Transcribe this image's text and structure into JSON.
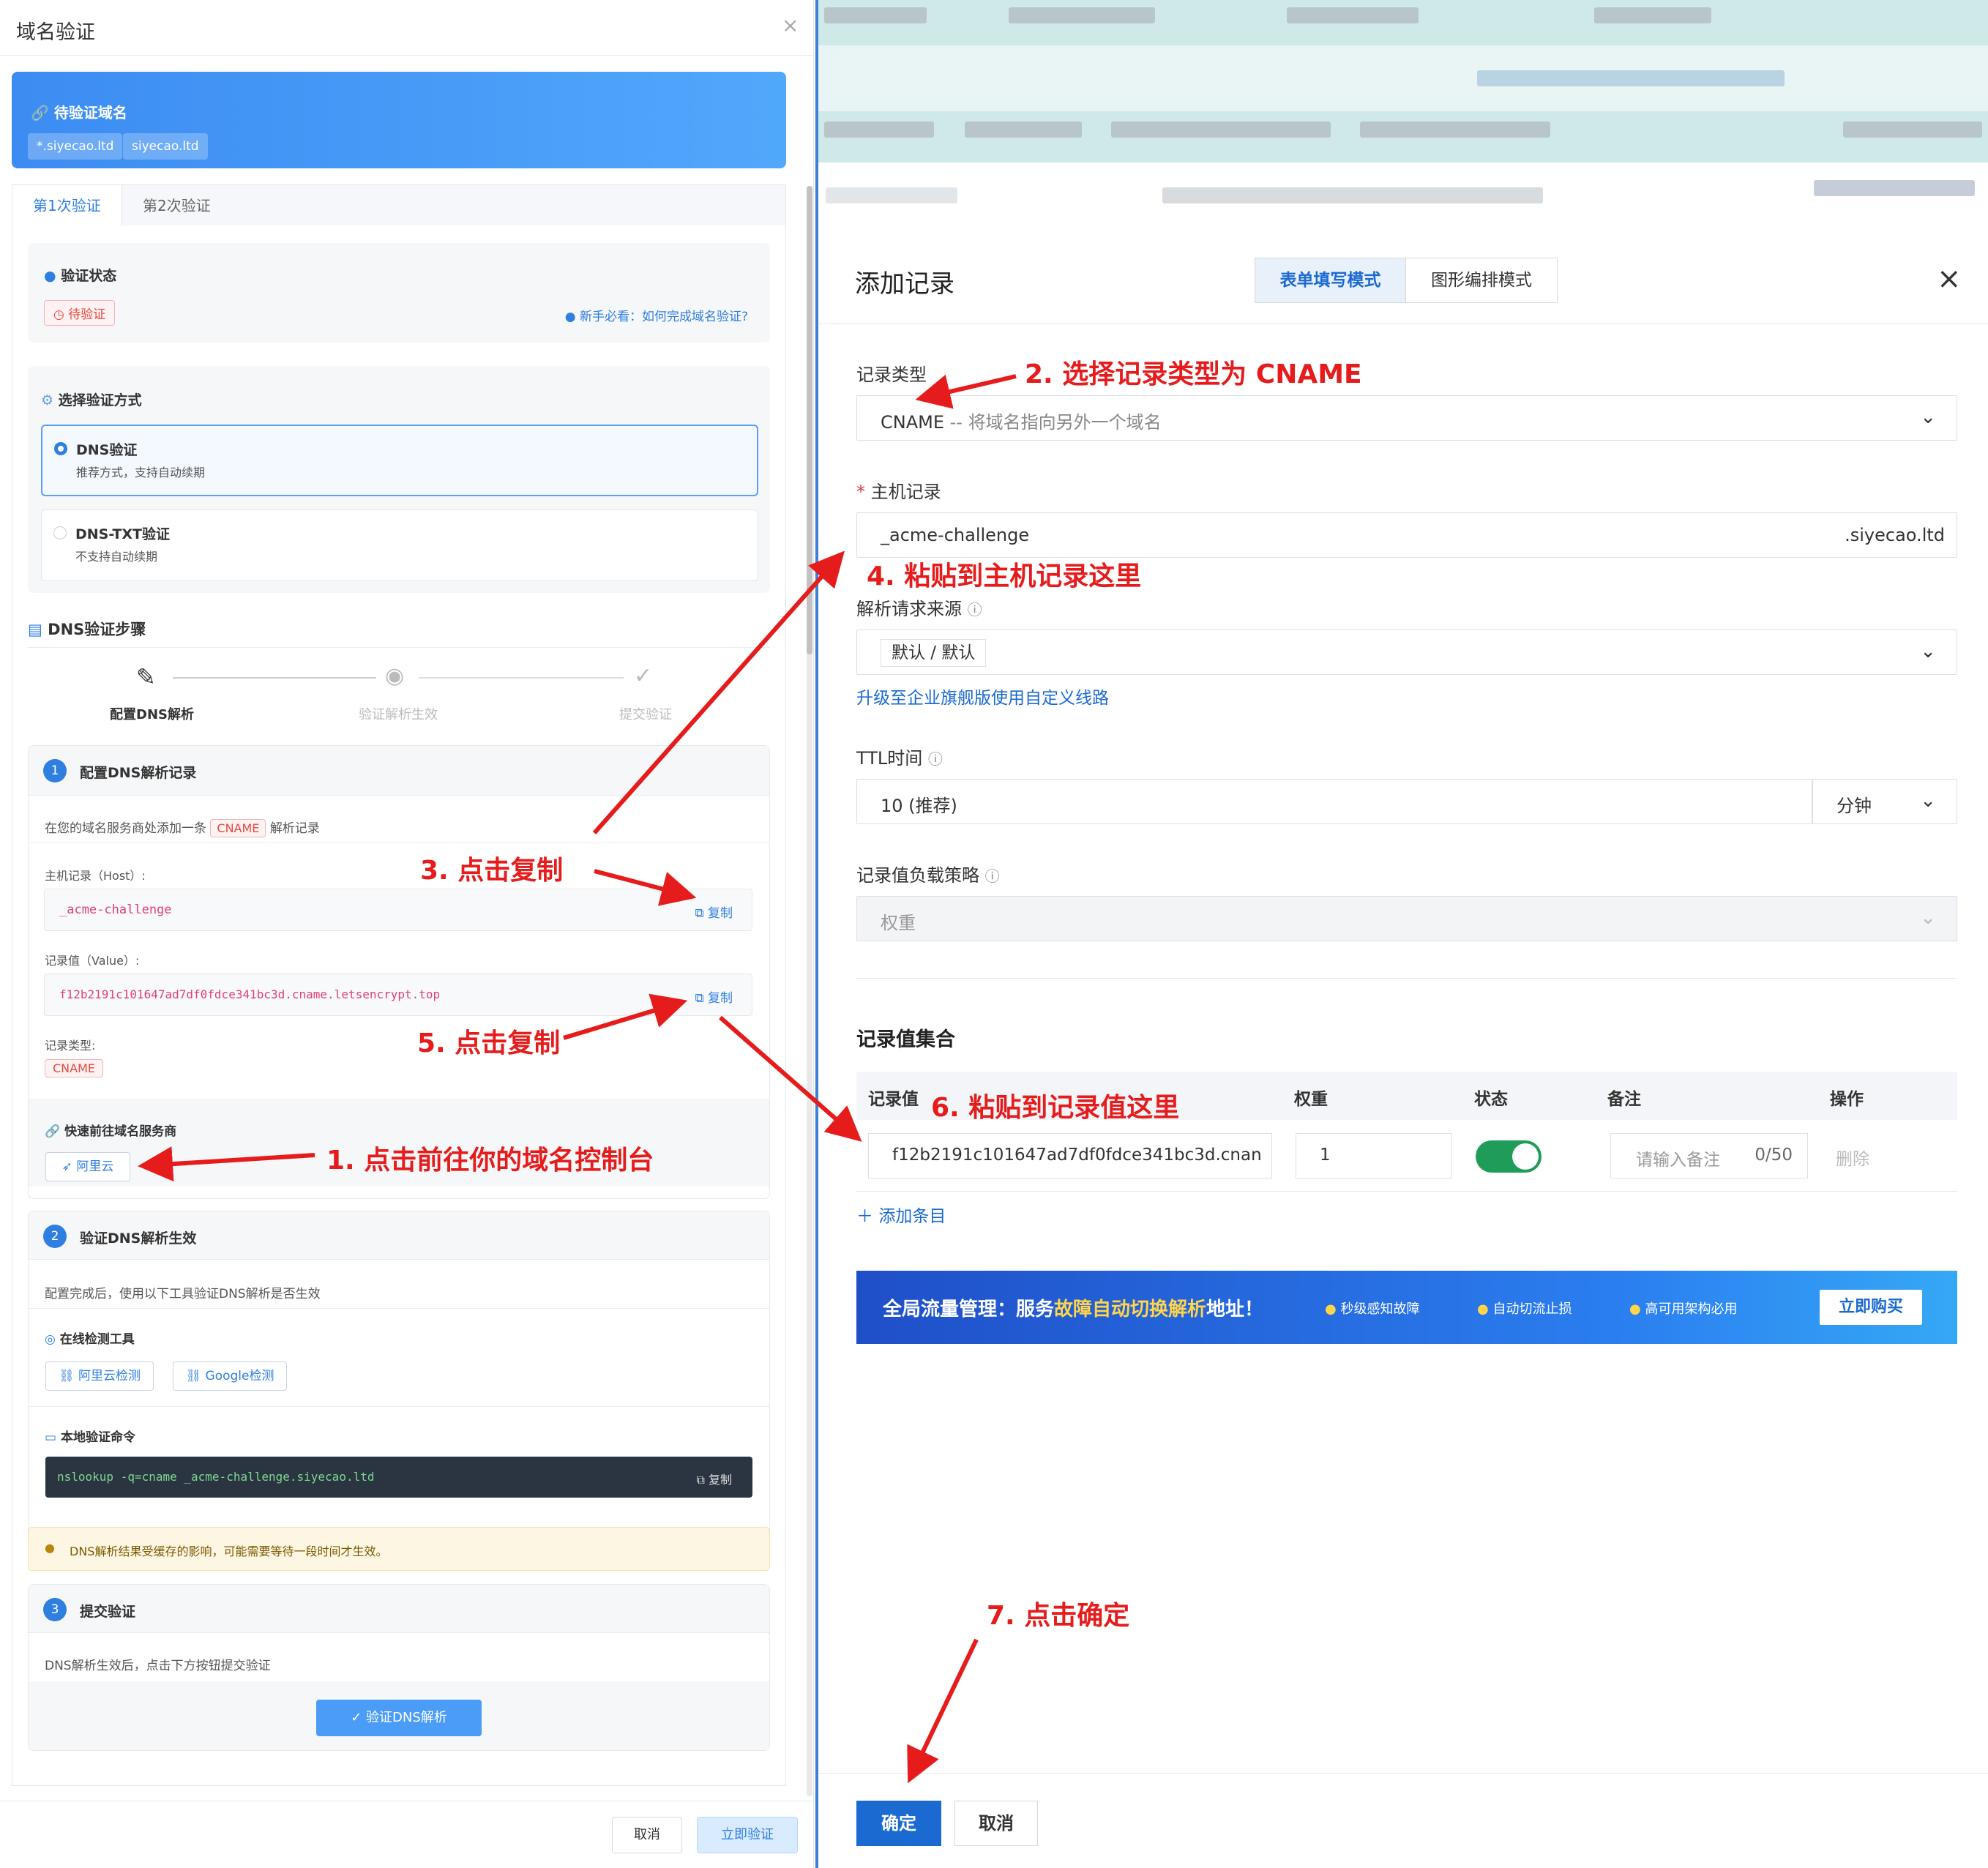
{
  "left": {
    "title": "域名验证",
    "close": "×",
    "banner": {
      "label": "待验证域名",
      "domains": [
        "*.siyecao.ltd",
        "siyecao.ltd"
      ]
    },
    "tabs": [
      "第1次验证",
      "第2次验证"
    ],
    "status": {
      "label": "验证状态",
      "badge": "待验证",
      "help": "新手必看：如何完成域名验证?"
    },
    "method": {
      "label": "选择验证方式",
      "options": [
        {
          "title": "DNS验证",
          "desc": "推荐方式，支持自动续期"
        },
        {
          "title": "DNS-TXT验证",
          "desc": "不支持自动续期"
        }
      ]
    },
    "steps_title": "DNS验证步骤",
    "steps": [
      "配置DNS解析",
      "验证解析生效",
      "提交验证"
    ],
    "step1": {
      "num": "1",
      "title": "配置DNS解析记录",
      "desc_pre": "在您的域名服务商处添加一条",
      "desc_tag": "CNAME",
      "desc_post": "解析记录",
      "host_label": "主机记录（Host）:",
      "host_value": "_acme-challenge",
      "value_label": "记录值（Value）:",
      "value_value": "f12b2191c101647ad7df0fdce341bc3d.cname.letsencrypt.top",
      "type_label": "记录类型:",
      "type_value": "CNAME",
      "copy": "复制",
      "provider_label": "快速前往域名服务商",
      "provider_btn": "阿里云"
    },
    "step2": {
      "num": "2",
      "title": "验证DNS解析生效",
      "desc": "配置完成后，使用以下工具验证DNS解析是否生效",
      "tools_label": "在线检测工具",
      "tools": [
        "阿里云检测",
        "Google检测"
      ],
      "cmd_label": "本地验证命令",
      "cmd": "nslookup -q=cname _acme-challenge.siyecao.ltd",
      "copy": "复制"
    },
    "warning": "DNS解析结果受缓存的影响，可能需要等待一段时间才生效。",
    "step3": {
      "num": "3",
      "title": "提交验证",
      "desc": "DNS解析生效后，点击下方按钮提交验证",
      "btn": "验证DNS解析"
    },
    "footer": {
      "cancel": "取消",
      "submit": "立即验证"
    }
  },
  "right": {
    "title": "添加记录",
    "modes": [
      "表单填写模式",
      "图形编排模式"
    ],
    "close": "×",
    "record_type_label": "记录类型",
    "record_type_value": "CNAME",
    "record_type_hint": " -- 将域名指向另外一个域名",
    "host_label": "主机记录",
    "host_value": "_acme-challenge",
    "host_suffix": ".siyecao.ltd",
    "source_label": "解析请求来源",
    "source_value": "默认 / 默认",
    "upgrade_link": "升级至企业旗舰版使用自定义线路",
    "ttl_label": "TTL时间",
    "ttl_value": "10 (推荐)",
    "ttl_unit": "分钟",
    "lb_label": "记录值负载策略",
    "lb_value": "权重",
    "set_title": "记录值集合",
    "table_headers": [
      "记录值",
      "权重",
      "状态",
      "备注",
      "操作"
    ],
    "row": {
      "value": "f12b2191c101647ad7df0fdce341bc3d.cnan",
      "weight": "1",
      "remark_placeholder": "请输入备注",
      "remark_count": "0/50",
      "action": "删除"
    },
    "add_item": "添加条目",
    "ad": {
      "prefix": "全局流量管理：服务",
      "highlight": "故障自动切换解析",
      "suffix": "地址！",
      "features": [
        "秒级感知故障",
        "自动切流止损",
        "高可用架构必用"
      ],
      "buy": "立即购买"
    },
    "ok": "确定",
    "cancel": "取消"
  },
  "annotations": [
    "1. 点击前往你的域名控制台",
    "2. 选择记录类型为 CNAME",
    "3. 点击复制",
    "4. 粘贴到主机记录这里",
    "5. 点击复制",
    "6. 粘贴到记录值这里",
    "7. 点击确定"
  ],
  "colors": {
    "accent": "#2f7fe0",
    "annotation": "#e61c1c",
    "confirm": "#1a6ad1",
    "toggle": "#1f9c57"
  }
}
